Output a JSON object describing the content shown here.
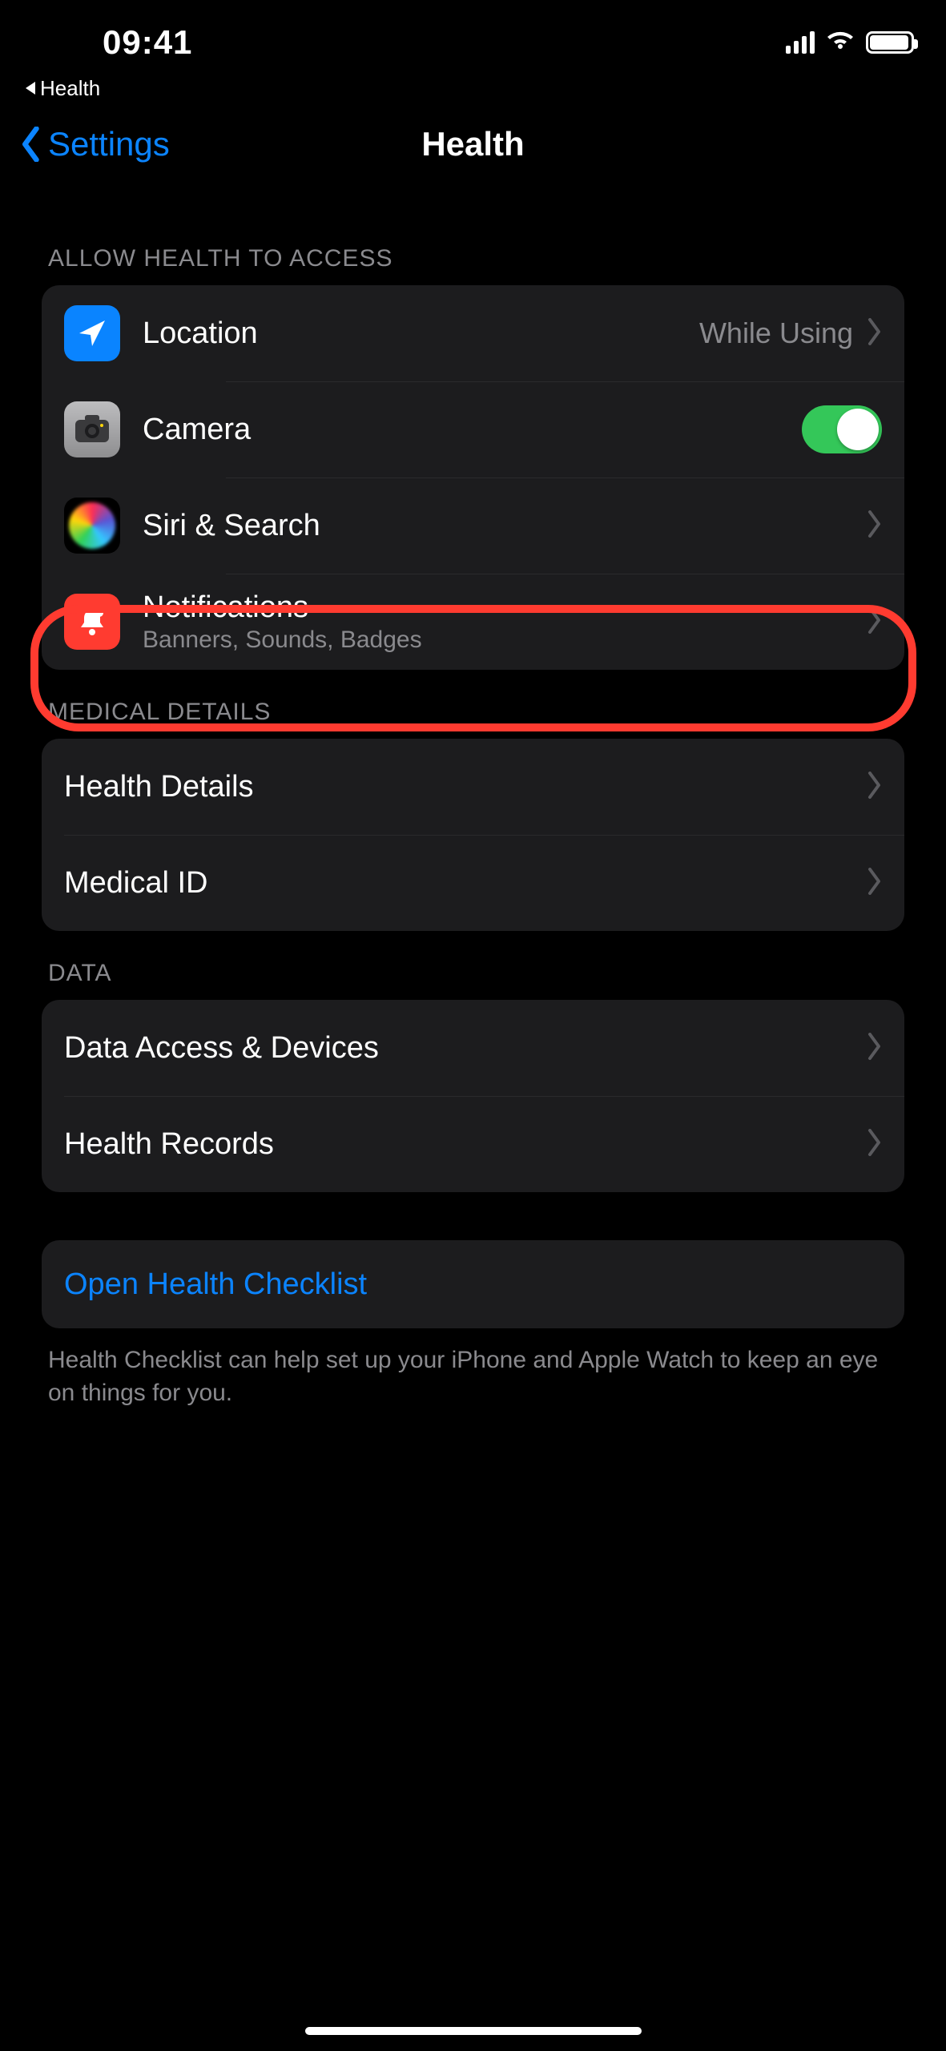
{
  "status": {
    "time": "09:41"
  },
  "breadcrumb": {
    "app": "Health"
  },
  "nav": {
    "back": "Settings",
    "title": "Health"
  },
  "sections": {
    "access": {
      "header": "ALLOW HEALTH TO ACCESS",
      "location": {
        "label": "Location",
        "detail": "While Using"
      },
      "camera": {
        "label": "Camera",
        "enabled": true
      },
      "siri": {
        "label": "Siri & Search"
      },
      "notifications": {
        "label": "Notifications",
        "sub": "Banners, Sounds, Badges"
      }
    },
    "medical": {
      "header": "MEDICAL DETAILS",
      "health_details": {
        "label": "Health Details"
      },
      "medical_id": {
        "label": "Medical ID"
      }
    },
    "data": {
      "header": "DATA",
      "access_devices": {
        "label": "Data Access & Devices"
      },
      "records": {
        "label": "Health Records"
      }
    },
    "checklist": {
      "open": "Open Health Checklist",
      "footer": "Health Checklist can help set up your iPhone and Apple Watch to keep an eye on things for you."
    }
  }
}
